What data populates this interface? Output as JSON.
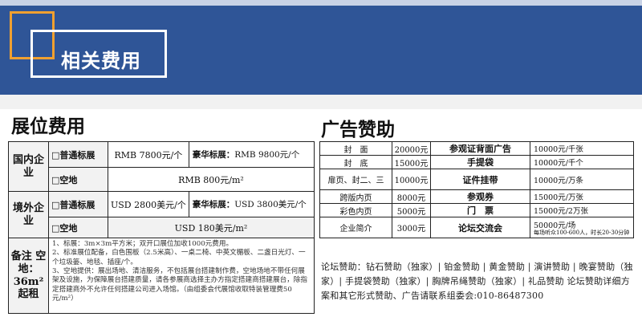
{
  "header": {
    "title": "相关费用"
  },
  "left": {
    "heading": "展位费用",
    "domestic": {
      "category": "国内企业",
      "standard_label": "□普通标展",
      "standard_price": "RMB 7800元/个",
      "luxury_label": "豪华标展：",
      "luxury_price": "RMB 9800元/个",
      "space_label": "□空地",
      "space_price": "RMB 800元/m²"
    },
    "overseas": {
      "category": "境外企业",
      "standard_label": "□普通标展",
      "standard_price": "USD 2800美元/个",
      "luxury_label": "豪华标展：",
      "luxury_price": "USD 3800美元/个",
      "space_label": "□空地",
      "space_price": "USD 180美元/m²"
    },
    "note": {
      "category": "备注 空地：36m² 起租",
      "lines": [
        "1、标展：3m×3m平方米；双开口展位加收1000元费用。",
        "2、标准展位配备，白色围板（2.5米高）、一桌二椅、中英文楣板、二盏日光灯、一个垃圾篓、地毯、插座/个。",
        "3、空地提供：展出场地、清洁服务，不包括展台搭建制作费，空地场地不带任何展架及设施，为保障展台搭建质量，请各参展商选择主办方指定搭建商搭建展台，除指定搭建商外不允许任何搭建公司进入场馆。（由组委会代展馆收取特装管理费50元/m²）"
      ]
    }
  },
  "right": {
    "heading": "广告赞助",
    "rows": [
      {
        "a": "封　面",
        "b": "20000元",
        "c": "参观证背面广告",
        "d": "10000元/千张"
      },
      {
        "a": "封　底",
        "b": "15000元",
        "c": "手提袋",
        "d": "10000元/千个"
      },
      {
        "a": "扉页、封二、三",
        "b": "10000元",
        "c": "证件挂带",
        "d": "10000元/万条"
      },
      {
        "a": "跨版内页",
        "b": "8000元",
        "c": "参观券",
        "d": "15000元/万张"
      },
      {
        "a": "彩色内页",
        "b": "5000元",
        "c": "门　票",
        "d": "15000元/2万张"
      },
      {
        "a": "企业简介",
        "b": "3000元",
        "c": "论坛交流会",
        "d": "50000元/场",
        "d_sub": "每场听众100-600人，时长20-30分钟"
      }
    ],
    "sponsor_text": "论坛赞助：钻石赞助（独家）| 铂金赞助 | 黄金赞助 | 演讲赞助 | 晚宴赞助（独家）| 手提袋赞助（独家）| 胸牌吊绳赞助（独家）| 礼品赞助 论坛赞助详细方案和其它形式赞助、广告请联系组委会:010-86487300"
  }
}
